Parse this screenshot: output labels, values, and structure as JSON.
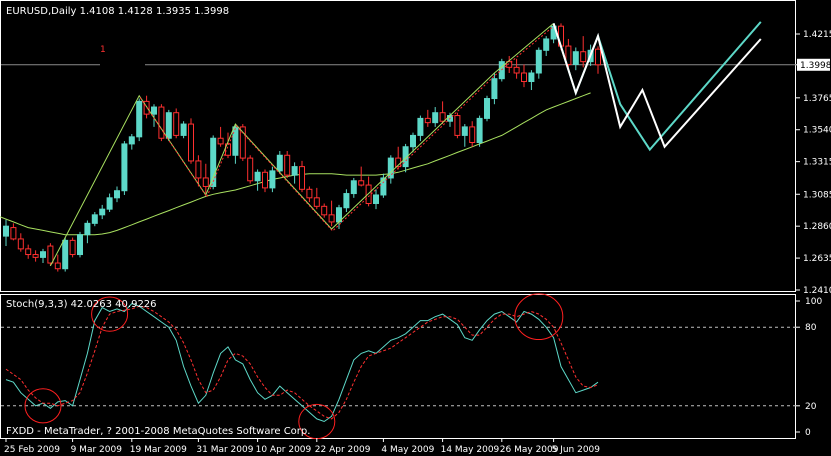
{
  "chart_data": [
    {
      "type": "candlestick",
      "title": "EURUSD,Daily  1.4108 1.4128 1.3935 1.3998",
      "symbol": "EURUSD",
      "timeframe": "Daily",
      "ohlc_header": {
        "open": "1.4108",
        "high": "1.4128",
        "low": "1.3935",
        "close": "1.3998"
      },
      "current_price_label": "1.3998",
      "marker_label": "1",
      "ylim": [
        1.241,
        1.4215
      ],
      "yticks": [
        "1.4215",
        "1.3998",
        "1.3765",
        "1.3540",
        "1.3315",
        "1.3085",
        "1.2860",
        "1.2635",
        "1.2410"
      ],
      "xticks": [
        "25 Feb 2009",
        "9 Mar 2009",
        "19 Mar 2009",
        "31 Mar 2009",
        "10 Apr 2009",
        "22 Apr 2009",
        "4 May 2009",
        "14 May 2009",
        "26 May 2009",
        "5 Jun 2009"
      ],
      "bull_color": "#5dd8c8",
      "bear_color": "#ff3030",
      "candles": [
        {
          "o": 1.279,
          "h": 1.2905,
          "l": 1.272,
          "c": 1.286
        },
        {
          "o": 1.285,
          "h": 1.288,
          "l": 1.276,
          "c": 1.277
        },
        {
          "o": 1.277,
          "h": 1.281,
          "l": 1.268,
          "c": 1.27
        },
        {
          "o": 1.27,
          "h": 1.273,
          "l": 1.263,
          "c": 1.266
        },
        {
          "o": 1.266,
          "h": 1.269,
          "l": 1.261,
          "c": 1.264
        },
        {
          "o": 1.264,
          "h": 1.27,
          "l": 1.26,
          "c": 1.268
        },
        {
          "o": 1.272,
          "h": 1.274,
          "l": 1.258,
          "c": 1.26
        },
        {
          "o": 1.26,
          "h": 1.266,
          "l": 1.254,
          "c": 1.256
        },
        {
          "o": 1.256,
          "h": 1.278,
          "l": 1.254,
          "c": 1.276
        },
        {
          "o": 1.276,
          "h": 1.278,
          "l": 1.264,
          "c": 1.266
        },
        {
          "o": 1.266,
          "h": 1.282,
          "l": 1.264,
          "c": 1.28
        },
        {
          "o": 1.28,
          "h": 1.29,
          "l": 1.274,
          "c": 1.288
        },
        {
          "o": 1.288,
          "h": 1.296,
          "l": 1.286,
          "c": 1.294
        },
        {
          "o": 1.294,
          "h": 1.301,
          "l": 1.291,
          "c": 1.298
        },
        {
          "o": 1.298,
          "h": 1.309,
          "l": 1.296,
          "c": 1.306
        },
        {
          "o": 1.306,
          "h": 1.314,
          "l": 1.303,
          "c": 1.311
        },
        {
          "o": 1.311,
          "h": 1.346,
          "l": 1.308,
          "c": 1.344
        },
        {
          "o": 1.344,
          "h": 1.351,
          "l": 1.34,
          "c": 1.349
        },
        {
          "o": 1.349,
          "h": 1.376,
          "l": 1.346,
          "c": 1.374
        },
        {
          "o": 1.374,
          "h": 1.378,
          "l": 1.362,
          "c": 1.365
        },
        {
          "o": 1.365,
          "h": 1.372,
          "l": 1.356,
          "c": 1.37
        },
        {
          "o": 1.37,
          "h": 1.372,
          "l": 1.346,
          "c": 1.348
        },
        {
          "o": 1.348,
          "h": 1.368,
          "l": 1.346,
          "c": 1.366
        },
        {
          "o": 1.366,
          "h": 1.369,
          "l": 1.348,
          "c": 1.35
        },
        {
          "o": 1.35,
          "h": 1.36,
          "l": 1.348,
          "c": 1.358
        },
        {
          "o": 1.358,
          "h": 1.362,
          "l": 1.33,
          "c": 1.332
        },
        {
          "o": 1.332,
          "h": 1.336,
          "l": 1.314,
          "c": 1.32
        },
        {
          "o": 1.32,
          "h": 1.33,
          "l": 1.308,
          "c": 1.314
        },
        {
          "o": 1.314,
          "h": 1.35,
          "l": 1.312,
          "c": 1.348
        },
        {
          "o": 1.348,
          "h": 1.356,
          "l": 1.342,
          "c": 1.344
        },
        {
          "o": 1.344,
          "h": 1.352,
          "l": 1.334,
          "c": 1.336
        },
        {
          "o": 1.336,
          "h": 1.358,
          "l": 1.33,
          "c": 1.356
        },
        {
          "o": 1.356,
          "h": 1.358,
          "l": 1.332,
          "c": 1.334
        },
        {
          "o": 1.334,
          "h": 1.336,
          "l": 1.316,
          "c": 1.318
        },
        {
          "o": 1.318,
          "h": 1.326,
          "l": 1.311,
          "c": 1.324
        },
        {
          "o": 1.324,
          "h": 1.326,
          "l": 1.31,
          "c": 1.313
        },
        {
          "o": 1.313,
          "h": 1.328,
          "l": 1.31,
          "c": 1.325
        },
        {
          "o": 1.325,
          "h": 1.339,
          "l": 1.323,
          "c": 1.336
        },
        {
          "o": 1.336,
          "h": 1.339,
          "l": 1.32,
          "c": 1.322
        },
        {
          "o": 1.322,
          "h": 1.331,
          "l": 1.316,
          "c": 1.328
        },
        {
          "o": 1.328,
          "h": 1.332,
          "l": 1.31,
          "c": 1.312
        },
        {
          "o": 1.312,
          "h": 1.314,
          "l": 1.303,
          "c": 1.306
        },
        {
          "o": 1.306,
          "h": 1.313,
          "l": 1.298,
          "c": 1.3
        },
        {
          "o": 1.3,
          "h": 1.302,
          "l": 1.292,
          "c": 1.294
        },
        {
          "o": 1.294,
          "h": 1.304,
          "l": 1.286,
          "c": 1.289
        },
        {
          "o": 1.289,
          "h": 1.301,
          "l": 1.284,
          "c": 1.299
        },
        {
          "o": 1.299,
          "h": 1.312,
          "l": 1.296,
          "c": 1.309
        },
        {
          "o": 1.309,
          "h": 1.32,
          "l": 1.306,
          "c": 1.318
        },
        {
          "o": 1.318,
          "h": 1.328,
          "l": 1.314,
          "c": 1.315
        },
        {
          "o": 1.315,
          "h": 1.321,
          "l": 1.3,
          "c": 1.302
        },
        {
          "o": 1.302,
          "h": 1.312,
          "l": 1.298,
          "c": 1.308
        },
        {
          "o": 1.308,
          "h": 1.323,
          "l": 1.306,
          "c": 1.32
        },
        {
          "o": 1.32,
          "h": 1.336,
          "l": 1.316,
          "c": 1.334
        },
        {
          "o": 1.334,
          "h": 1.342,
          "l": 1.326,
          "c": 1.328
        },
        {
          "o": 1.328,
          "h": 1.344,
          "l": 1.324,
          "c": 1.342
        },
        {
          "o": 1.342,
          "h": 1.352,
          "l": 1.338,
          "c": 1.35
        },
        {
          "o": 1.35,
          "h": 1.364,
          "l": 1.346,
          "c": 1.362
        },
        {
          "o": 1.362,
          "h": 1.368,
          "l": 1.356,
          "c": 1.359
        },
        {
          "o": 1.359,
          "h": 1.37,
          "l": 1.356,
          "c": 1.366
        },
        {
          "o": 1.366,
          "h": 1.374,
          "l": 1.358,
          "c": 1.36
        },
        {
          "o": 1.36,
          "h": 1.366,
          "l": 1.356,
          "c": 1.364
        },
        {
          "o": 1.364,
          "h": 1.366,
          "l": 1.348,
          "c": 1.35
        },
        {
          "o": 1.35,
          "h": 1.358,
          "l": 1.342,
          "c": 1.356
        },
        {
          "o": 1.356,
          "h": 1.36,
          "l": 1.342,
          "c": 1.345
        },
        {
          "o": 1.345,
          "h": 1.364,
          "l": 1.342,
          "c": 1.362
        },
        {
          "o": 1.362,
          "h": 1.378,
          "l": 1.36,
          "c": 1.376
        },
        {
          "o": 1.376,
          "h": 1.394,
          "l": 1.372,
          "c": 1.39
        },
        {
          "o": 1.39,
          "h": 1.404,
          "l": 1.388,
          "c": 1.402
        },
        {
          "o": 1.402,
          "h": 1.406,
          "l": 1.394,
          "c": 1.398
        },
        {
          "o": 1.398,
          "h": 1.404,
          "l": 1.39,
          "c": 1.394
        },
        {
          "o": 1.394,
          "h": 1.4,
          "l": 1.384,
          "c": 1.388
        },
        {
          "o": 1.388,
          "h": 1.396,
          "l": 1.382,
          "c": 1.394
        },
        {
          "o": 1.394,
          "h": 1.412,
          "l": 1.39,
          "c": 1.41
        },
        {
          "o": 1.41,
          "h": 1.42,
          "l": 1.406,
          "c": 1.418
        },
        {
          "o": 1.418,
          "h": 1.429,
          "l": 1.415,
          "c": 1.427
        },
        {
          "o": 1.427,
          "h": 1.429,
          "l": 1.41,
          "c": 1.413
        },
        {
          "o": 1.413,
          "h": 1.418,
          "l": 1.398,
          "c": 1.4
        },
        {
          "o": 1.4,
          "h": 1.412,
          "l": 1.396,
          "c": 1.409
        },
        {
          "o": 1.409,
          "h": 1.42,
          "l": 1.398,
          "c": 1.402
        },
        {
          "o": 1.402,
          "h": 1.414,
          "l": 1.399,
          "c": 1.41
        },
        {
          "o": 1.4108,
          "h": 1.4128,
          "l": 1.3935,
          "c": 1.3998
        }
      ],
      "moving_average": {
        "color": "#a8e060",
        "values": [
          1.293,
          1.291,
          1.289,
          1.287,
          1.285,
          1.284,
          1.283,
          1.282,
          1.281,
          1.28,
          1.28,
          1.28,
          1.28,
          1.28,
          1.2805,
          1.2815,
          1.283,
          1.285,
          1.287,
          1.289,
          1.291,
          1.293,
          1.295,
          1.297,
          1.299,
          1.301,
          1.303,
          1.305,
          1.307,
          1.3085,
          1.3095,
          1.3105,
          1.3115,
          1.313,
          1.3145,
          1.316,
          1.3175,
          1.319,
          1.32,
          1.321,
          1.322,
          1.3225,
          1.323,
          1.323,
          1.323,
          1.323,
          1.3225,
          1.322,
          1.322,
          1.322,
          1.322,
          1.322,
          1.3225,
          1.323,
          1.324,
          1.3255,
          1.327,
          1.3285,
          1.33,
          1.332,
          1.334,
          1.336,
          1.338,
          1.34,
          1.342,
          1.344,
          1.346,
          1.348,
          1.35,
          1.353,
          1.356,
          1.359,
          1.362,
          1.365,
          1.368,
          1.37,
          1.372,
          1.374,
          1.376,
          1.378,
          1.38
        ]
      },
      "zigzag": {
        "color": "#a8e060",
        "points": [
          [
            6,
            1.258
          ],
          [
            18,
            1.378
          ],
          [
            27,
            1.308
          ],
          [
            31,
            1.358
          ],
          [
            44,
            1.284
          ],
          [
            66,
            1.394
          ],
          [
            74,
            1.429
          ]
        ]
      },
      "red_zigzag_segments": {
        "color": "#ff3030",
        "points": [
          [
            18,
            1.378
          ],
          [
            27,
            1.308
          ],
          [
            31,
            1.358
          ],
          [
            44,
            1.284
          ],
          [
            66,
            1.394
          ],
          [
            74,
            1.429
          ]
        ]
      },
      "projection_white": {
        "color": "#ffffff",
        "points": [
          [
            74,
            1.429
          ],
          [
            77,
            1.38
          ],
          [
            80,
            1.42
          ],
          [
            83,
            1.356
          ],
          [
            86,
            1.382
          ],
          [
            89,
            1.342
          ],
          [
            102,
            1.418
          ]
        ]
      },
      "projection_cyan": {
        "color": "#5dd8c8",
        "points": [
          [
            74,
            1.429
          ],
          [
            77,
            1.38
          ],
          [
            80,
            1.42
          ],
          [
            83,
            1.372
          ],
          [
            87,
            1.34
          ],
          [
            102,
            1.43
          ]
        ]
      }
    },
    {
      "type": "line",
      "title": "Stoch(9,3,3) 42.0263 40.9226",
      "ylim": [
        0,
        100
      ],
      "yticks": [
        "100",
        "80",
        "20",
        "0"
      ],
      "levels": [
        80,
        20
      ],
      "series": [
        {
          "color": "#5dd8c8",
          "style": "solid",
          "values": [
            40,
            38,
            30,
            25,
            20,
            22,
            18,
            23,
            24,
            20,
            40,
            60,
            85,
            95,
            92,
            94,
            92,
            98,
            96,
            92,
            88,
            84,
            80,
            70,
            50,
            35,
            22,
            28,
            45,
            60,
            65,
            55,
            52,
            40,
            30,
            25,
            28,
            35,
            30,
            25,
            20,
            15,
            10,
            8,
            12,
            25,
            40,
            55,
            60,
            62,
            60,
            65,
            70,
            72,
            75,
            80,
            85,
            85,
            88,
            90,
            86,
            82,
            72,
            70,
            78,
            85,
            90,
            92,
            88,
            84,
            92,
            90,
            86,
            80,
            72,
            50,
            40,
            30,
            32,
            34,
            38
          ]
        },
        {
          "color": "#ff3030",
          "style": "dashed",
          "values": [
            48,
            44,
            40,
            32,
            26,
            22,
            22,
            20,
            22,
            24,
            30,
            45,
            62,
            80,
            90,
            92,
            93,
            94,
            96,
            95,
            92,
            88,
            84,
            78,
            68,
            55,
            40,
            30,
            32,
            42,
            55,
            60,
            58,
            52,
            42,
            34,
            28,
            28,
            32,
            30,
            25,
            20,
            16,
            12,
            10,
            15,
            25,
            38,
            50,
            58,
            60,
            62,
            64,
            68,
            72,
            76,
            80,
            84,
            86,
            88,
            88,
            86,
            80,
            74,
            74,
            80,
            86,
            90,
            90,
            88,
            90,
            92,
            90,
            86,
            80,
            68,
            55,
            42,
            35,
            34,
            36
          ]
        }
      ],
      "circles": [
        {
          "x": 5,
          "y": 20
        },
        {
          "x": 14,
          "y": 90
        },
        {
          "x": 42,
          "y": 8
        },
        {
          "x": 72,
          "y": 88
        }
      ]
    }
  ],
  "footer": {
    "copyright": "FXDD - MetaTrader, ? 2001-2008 MetaQuotes Software Corp."
  }
}
